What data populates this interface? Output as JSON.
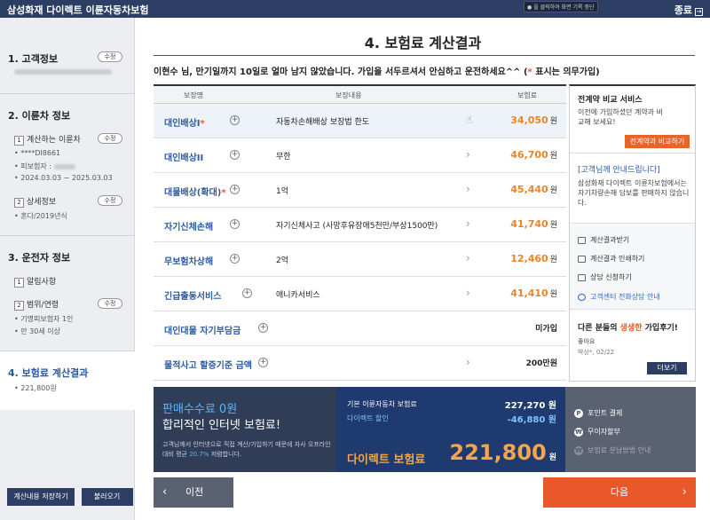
{
  "app": {
    "title": "삼성화재 다이렉트 이륜자동차보험",
    "recording": "● 을 클릭하여 화면 기록 중단",
    "close_label": "종료"
  },
  "sidebar": {
    "sections": [
      {
        "heading": "1. 고객정보",
        "edit": "수정"
      },
      {
        "heading": "2. 이륜차 정보",
        "sub1": {
          "num": "1",
          "label": "계산하는 이륜차",
          "edit": "수정"
        },
        "sub1_lines": [
          "• ****DI8661",
          "• 피보험자 :",
          "• 2024.03.03 ~ 2025.03.03"
        ],
        "sub2": {
          "num": "2",
          "label": "상세정보",
          "edit": "수정"
        },
        "sub2_lines": [
          "• 혼다/2019년식"
        ]
      },
      {
        "heading": "3. 운전자 정보",
        "sub1": {
          "num": "1",
          "label": "알림사항"
        },
        "sub2": {
          "num": "2",
          "label": "범위/연령",
          "edit": "수정"
        },
        "sub2_lines": [
          "• 기명피보험자 1인",
          "• 만 30세 이상"
        ]
      },
      {
        "heading": "4. 보험료 계산결과",
        "lines": [
          "• 221,800원"
        ]
      }
    ],
    "buttons": {
      "save": "계산내용 저장하기",
      "load": "불러오기"
    }
  },
  "main": {
    "title": "4. 보험료 계산결과",
    "notice_main": "이현수 님, 만기일까지 10일로 얼마 남지 않았습니다. 가입을 서두르셔서 안심하고 운전하세요^^ (",
    "notice_star": "*",
    "notice_tail": " 표시는 의무가입)",
    "table": {
      "headers": [
        "보장명",
        "보장내용",
        "보험료"
      ],
      "rows": [
        {
          "name": "대인배상I",
          "required": "*",
          "coverage": "자동차손해배상 보장법 한도",
          "premium": "34,050",
          "unit": "원"
        },
        {
          "name": "대인배상II",
          "required": "",
          "coverage": "무한",
          "premium": "46,700",
          "unit": "원"
        },
        {
          "name": "대물배상(확대)",
          "required": "*",
          "coverage": "1억",
          "premium": "45,440",
          "unit": "원"
        },
        {
          "name": "자기신체손해",
          "required": "",
          "coverage": "자기신체사고 (사망후유장애5천만/부상1500만)",
          "premium": "41,740",
          "unit": "원"
        },
        {
          "name": "무보험차상해",
          "required": "",
          "coverage": "2억",
          "premium": "12,460",
          "unit": "원"
        },
        {
          "name": "긴급출동서비스",
          "required": "",
          "coverage": "애니카서비스",
          "premium": "41,410",
          "unit": "원"
        },
        {
          "name": "대인대물 자기부담금",
          "required": "",
          "coverage": "",
          "premium": "미가입",
          "unit": ""
        },
        {
          "name": "물적사고 할증기준 금액",
          "required": "",
          "coverage": "",
          "premium": "200만원",
          "unit": ""
        }
      ]
    },
    "right_panel": {
      "compare_title": "전계약 비교 서비스",
      "compare_text": "이전에 가입하셨던 계약과 비교해 보세요!",
      "compare_button": "전계약과 비교하기",
      "info_title": "[고객님께 안내드립니다]",
      "info_text": "삼성화재 다이렉트 이륜차보험에서는 자기차량손해 담보를 판매하지 않습니다.",
      "links": [
        "계산결과받기",
        "계산결과 인쇄하기",
        "상담 신청하기",
        "고객센터 전화상담 안내"
      ],
      "review_title_a": "다른 분들의 ",
      "review_title_b": "생생한",
      "review_title_c": " 가입후기!",
      "review_text": "좋아요",
      "review_author": "박상*, 02/22",
      "review_more": "더보기"
    },
    "summary": {
      "fee_line": "판매수수료 0원",
      "fee_sub": "합리적인 인터넷 보험료!",
      "desc_a": "고객님께서 인터넷으로 직접 계산/가입하기 때문에 자사 오프라인 대비 평균 ",
      "desc_pct": "20.7%",
      "desc_b": " 저렴합니다.",
      "base_label": "기본 이륜자동차 보험료",
      "base_value": "227,270 원",
      "discount_label": "다이렉트 할인",
      "discount_value": "-46,880 원",
      "final_label": "다이렉트 보험료",
      "final_value": "221,800",
      "final_unit": "원",
      "options": [
        {
          "icon": "P",
          "label": "포인트 결제"
        },
        {
          "icon": "₩",
          "label": "무이자할부"
        },
        {
          "icon": "₩",
          "label": "보험료 분납방법 안내"
        }
      ]
    },
    "nav": {
      "prev": "이전",
      "next": "다음"
    }
  }
}
